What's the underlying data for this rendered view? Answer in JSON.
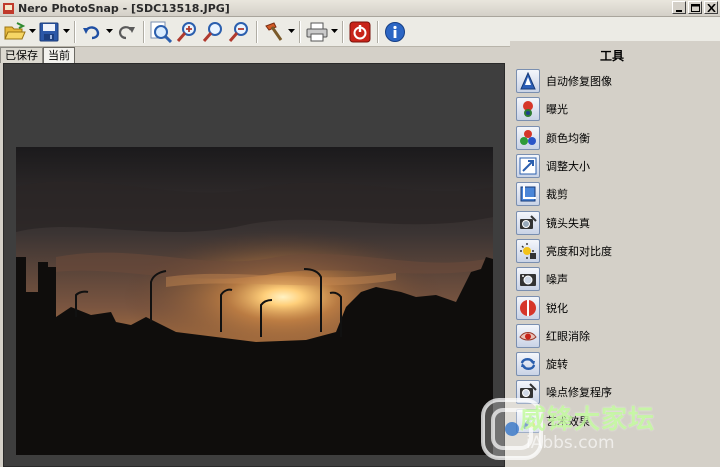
{
  "window": {
    "title": "Nero PhotoSnap - [SDC13518.JPG]"
  },
  "toolbar": {
    "buttons": [
      {
        "name": "open-icon",
        "has_dropdown": true
      },
      {
        "name": "save-icon",
        "has_dropdown": true
      },
      {
        "name": "undo-icon",
        "has_dropdown": true
      },
      {
        "name": "redo-icon",
        "has_dropdown": false
      },
      {
        "name": "fit-window-icon",
        "has_dropdown": false
      },
      {
        "name": "zoom-in-icon",
        "has_dropdown": false
      },
      {
        "name": "zoom-actual-icon",
        "has_dropdown": false
      },
      {
        "name": "zoom-out-icon",
        "has_dropdown": false
      },
      {
        "name": "hammer-tools-icon",
        "has_dropdown": true
      },
      {
        "name": "print-icon",
        "has_dropdown": true
      },
      {
        "name": "power-exit-icon",
        "has_dropdown": false
      },
      {
        "name": "info-icon",
        "has_dropdown": false
      }
    ]
  },
  "tabs": [
    {
      "label": "已保存",
      "active": false
    },
    {
      "label": "当前",
      "active": true
    }
  ],
  "panel": {
    "title": "工具",
    "tools": [
      {
        "label": "自动修复图像",
        "icon": "auto-fix-icon"
      },
      {
        "label": "曝光",
        "icon": "exposure-icon"
      },
      {
        "label": "颜色均衡",
        "icon": "color-balance-icon"
      },
      {
        "label": "调整大小",
        "icon": "resize-icon"
      },
      {
        "label": "裁剪",
        "icon": "crop-icon"
      },
      {
        "label": "镜头失真",
        "icon": "lens-distortion-icon"
      },
      {
        "label": "亮度和对比度",
        "icon": "brightness-contrast-icon"
      },
      {
        "label": "噪声",
        "icon": "noise-icon"
      },
      {
        "label": "锐化",
        "icon": "sharpen-icon"
      },
      {
        "label": "红眼消除",
        "icon": "red-eye-icon"
      },
      {
        "label": "旋转",
        "icon": "rotate-icon"
      },
      {
        "label": "噪点修复程序",
        "icon": "noise-repair-icon"
      },
      {
        "label": "艺术效果",
        "icon": "art-effects-icon"
      }
    ]
  },
  "image": {
    "filename": "SDC13518.JPG"
  },
  "watermark": {
    "text": "威锋大家坛",
    "url": "iAbbs.com"
  },
  "colors": {
    "chrome": "#d4d0c8",
    "canvas": "#3e3e3e",
    "sun": "#ffd27a"
  }
}
